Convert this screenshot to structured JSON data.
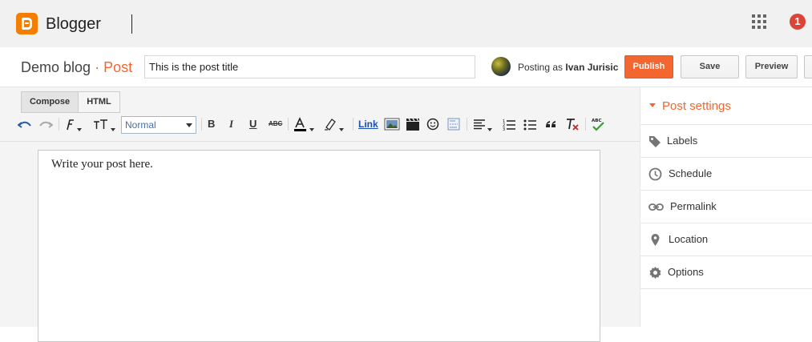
{
  "app": {
    "brand": "Blogger",
    "notifications": "1"
  },
  "postbar": {
    "blog_name": "Demo blog",
    "separator": "·",
    "section": "Post",
    "title_value": "This is the post title",
    "posting_as_prefix": "Posting as",
    "author": "Ivan Jurisic",
    "publish_label": "Publish",
    "save_label": "Save",
    "preview_label": "Preview"
  },
  "editor": {
    "tabs": [
      {
        "label": "Compose"
      },
      {
        "label": "HTML"
      }
    ],
    "format_value": "Normal",
    "link_label": "Link",
    "body_text": "Write your post here."
  },
  "sidebar": {
    "heading": "Post settings",
    "items": [
      {
        "label": "Labels",
        "icon": "tag-icon"
      },
      {
        "label": "Schedule",
        "icon": "clock-icon"
      },
      {
        "label": "Permalink",
        "icon": "link-icon"
      },
      {
        "label": "Location",
        "icon": "map-pin-icon"
      },
      {
        "label": "Options",
        "icon": "gear-icon"
      }
    ]
  },
  "colors": {
    "accent": "#f4662f",
    "logo": "#f57d00",
    "notification": "#db4437"
  }
}
